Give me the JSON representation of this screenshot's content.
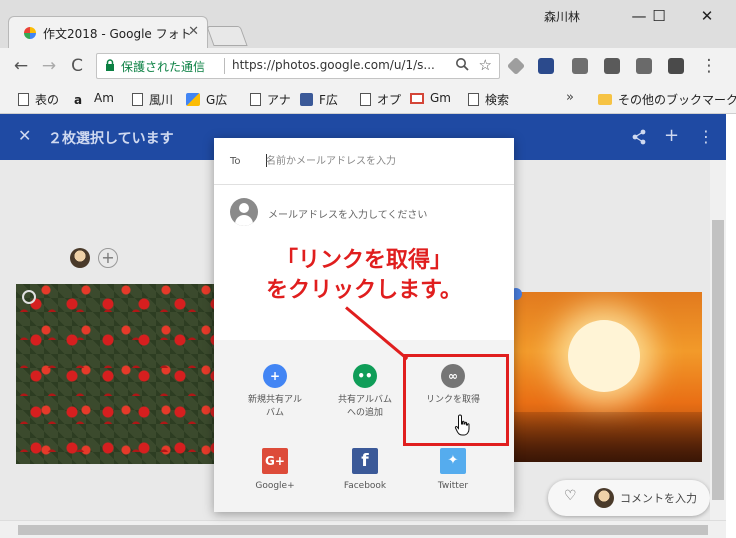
{
  "browser": {
    "tab": {
      "title": "作文2018 - Google フォト",
      "close": "✕"
    },
    "window": {
      "user": "森川林",
      "minimize": "—",
      "maximize": "☐",
      "close": "✕"
    },
    "toolbar": {
      "back": "←",
      "forward": "→",
      "reload": "C",
      "secure_label": "保護された通信",
      "url": "https://photos.google.com/u/1/s...",
      "menu": "⋮"
    },
    "bookmarks": [
      {
        "label": "表の",
        "icon": "document-icon"
      },
      {
        "label": "Am",
        "icon": "amazon-icon"
      },
      {
        "label": "風川",
        "icon": "document-icon"
      },
      {
        "label": "G広",
        "icon": "google-ads-icon"
      },
      {
        "label": "アナ",
        "icon": "document-icon"
      },
      {
        "label": "F広",
        "icon": "facebook-icon"
      },
      {
        "label": "オプ",
        "icon": "document-icon"
      },
      {
        "label": "Gm",
        "icon": "gmail-icon"
      },
      {
        "label": "検索",
        "icon": "document-icon"
      }
    ],
    "bookmarks_more": "»",
    "other_bookmarks": "その他のブックマーク"
  },
  "photos": {
    "selection_close": "✕",
    "selection_count": "２枚選択しています",
    "add_person": "+",
    "comment": {
      "heart": "♡",
      "label": "コメントを入力"
    }
  },
  "share_dialog": {
    "to_label": "To",
    "to_placeholder": "名前かメールアドレスを入力",
    "email_prompt": "メールアドレスを入力してください",
    "options": [
      {
        "label": "新規共有アルバム",
        "icon": "new-shared-album-icon",
        "color": "#4285f4"
      },
      {
        "label": "共有アルバムへの追加",
        "icon": "add-to-shared-album-icon",
        "color": "#0f9d58"
      },
      {
        "label": "リンクを取得",
        "icon": "link-icon",
        "color": "#757575"
      },
      {
        "label": "Google+",
        "icon": "google-plus-icon",
        "color": "#dd4b39"
      },
      {
        "label": "Facebook",
        "icon": "facebook-icon",
        "color": "#3b5998"
      },
      {
        "label": "Twitter",
        "icon": "twitter-icon",
        "color": "#55acee"
      }
    ]
  },
  "annotation": {
    "line1": "「リンクを取得」",
    "line2": "をクリックします。",
    "color": "#e01e1e"
  }
}
